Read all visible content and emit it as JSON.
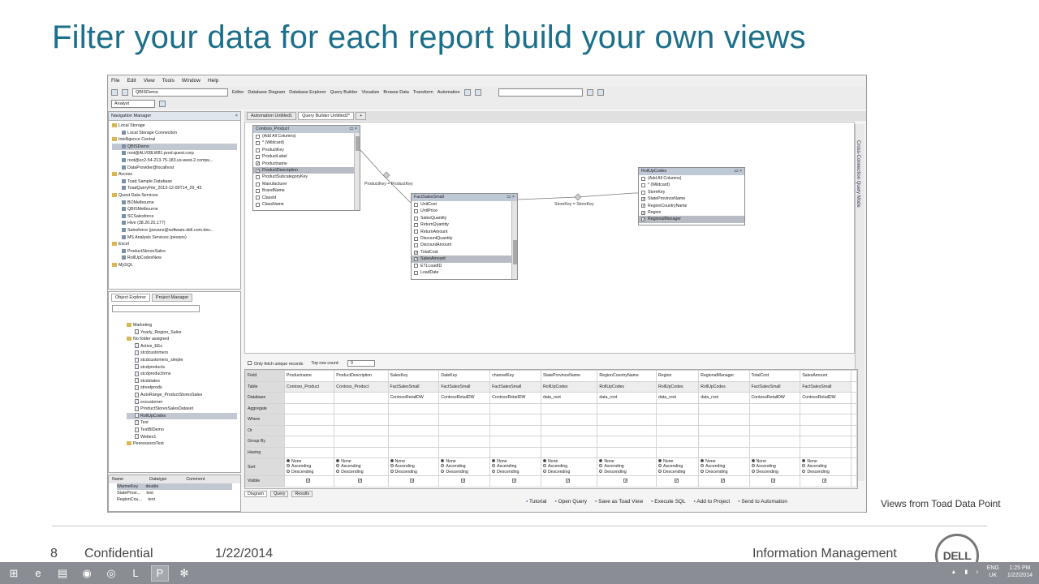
{
  "slide": {
    "title": "Filter your data for each report build your own views",
    "caption": "Views from Toad Data Point",
    "page_number": "8",
    "confidential": "Confidential",
    "date": "1/22/2014",
    "section": "Information Management",
    "logo_text": "DELL"
  },
  "app": {
    "menu": [
      "File",
      "Edit",
      "View",
      "Tools",
      "Window",
      "Help"
    ],
    "connection_combo": "QBISDemo",
    "role_combo": "Analyst",
    "toolbar": [
      "Editor",
      "Database Diagram",
      "Database Explorer",
      "Query Builder",
      "Visualize",
      "Browse Data",
      "Transform",
      "Automation"
    ],
    "navigation_manager": {
      "title": "Navigation Manager",
      "items": [
        "Local Storage",
        "Local Storage Connection",
        "Intelligence Central",
        "QBISDemo",
        "root@ALV08LW81.prod.quest.corp",
        "root@ec2-54-213-75-183.us-west-2.compu...",
        "DataProvider@localhost",
        "Access",
        "Toad Sample Database",
        "ToadQueryFile_2013-12-09T14_29_43",
        "Quest Data Services",
        "BOMelbourne",
        "QBISMelbourne",
        "SCSalesforce",
        "Hive (38.20.25.177)",
        "Salesforce (pevans@software.dell.com.dev...",
        "MS Analysis Services (pevans)",
        "Excel",
        "ProductStoresSales",
        "RollUpCodesNew",
        "MySQL"
      ]
    },
    "object_explorer": {
      "tabs": [
        "Object Explorer",
        "Project Manager"
      ],
      "items": [
        "Marketing",
        "Yearly_Region_Sales",
        "No folder assigned",
        "Active_EEs",
        "stcdcustomers",
        "stcdcustomers_simple",
        "stcdproducts",
        "stcdproductnms",
        "stcdstates",
        "streetprods",
        "AutoRange_ProductStoresSales",
        "evcustomer",
        "ProductStoresSalesDataset",
        "RollUpCodes",
        "Test",
        "TestBIDemo",
        "Webex1",
        "PeeressonsTest"
      ],
      "props_headers": [
        "Name",
        "Datatype",
        "Comment"
      ],
      "props_rows": [
        [
          "WarmeKey",
          "double",
          ""
        ],
        [
          "StateProvi...",
          "text",
          ""
        ],
        [
          "RegionCou...",
          "text",
          ""
        ]
      ]
    },
    "doc_tabs": [
      "Automation Untitled1",
      "Query Builder Untitled2*",
      "+"
    ],
    "tables": {
      "product": {
        "title": "Contoso_Product",
        "rows": [
          "(Add All Columns)",
          "* (Wildcard)",
          "ProductKey",
          "ProductLabel",
          "Productname",
          "ProductDescription",
          "ProductSubcategoryKey",
          "Manufacturer",
          "BrandName",
          "ClassId",
          "ClassName"
        ]
      },
      "fact": {
        "title": "FactSalesSmall",
        "rows": [
          "UnitCost",
          "UnitPrice",
          "SalesQuantity",
          "ReturnQuantity",
          "ReturnAmount",
          "DiscountQuantity",
          "DiscountAmount",
          "TotalCost",
          "SalesAmount",
          "ETLLoadID",
          "LoadDate"
        ]
      },
      "rollup": {
        "title": "RollUpCodes",
        "rows": [
          "(Add All Columns)",
          "* (Wildcard)",
          "StoreKey",
          "StateProvinceName",
          "RegionCountryName",
          "Region",
          "RegionalManager"
        ]
      }
    },
    "joins": [
      "ProductKey = ProductKey",
      "StoreKey = StoreKey"
    ],
    "side_tab": "Cross-Connection Query Mode",
    "grid": {
      "unique_label": "Only fetch unique records",
      "top_label": "Top row count:",
      "top_value": "0",
      "row_labels": [
        "Field",
        "Table",
        "Database",
        "Aggregate",
        "Where",
        "Or",
        "Group By",
        "Having",
        "Sort",
        "Visible"
      ],
      "fields": [
        "Productname",
        "ProductDescription",
        "SalesKey",
        "DateKey",
        "channelKey",
        "StateProvinceName",
        "RegionCountryName",
        "Region",
        "RegionalManager",
        "TotalCost",
        "SalesAmount"
      ],
      "tables": [
        "Contoso_Product",
        "Contoso_Product",
        "FactSalesSmall",
        "FactSalesSmall",
        "FactSalesSmall",
        "RollUpCodes",
        "RollUpCodes",
        "RollUpCodes",
        "RollUpCodes",
        "FactSalesSmall",
        "FactSalesSmall"
      ],
      "databases": [
        "",
        "",
        "ContosoRetailDW",
        "ContosoRetailDW",
        "ContosoRetailDW",
        "data_root",
        "data_root",
        "data_root",
        "data_root",
        "ContosoRetailDW",
        "ContosoRetailDW"
      ],
      "sort_options": [
        "None",
        "Ascending",
        "Descending"
      ],
      "bottom_tabs": [
        "Diagram",
        "Query",
        "Results"
      ]
    },
    "actions": [
      "Tutorial",
      "Open Query",
      "Save as Toad View",
      "Execute SQL",
      "Add to Project",
      "Send to Automation"
    ]
  },
  "taskbar": {
    "language": "ENG",
    "region": "UK",
    "time": "1:25 PM",
    "date": "1/22/2014"
  }
}
